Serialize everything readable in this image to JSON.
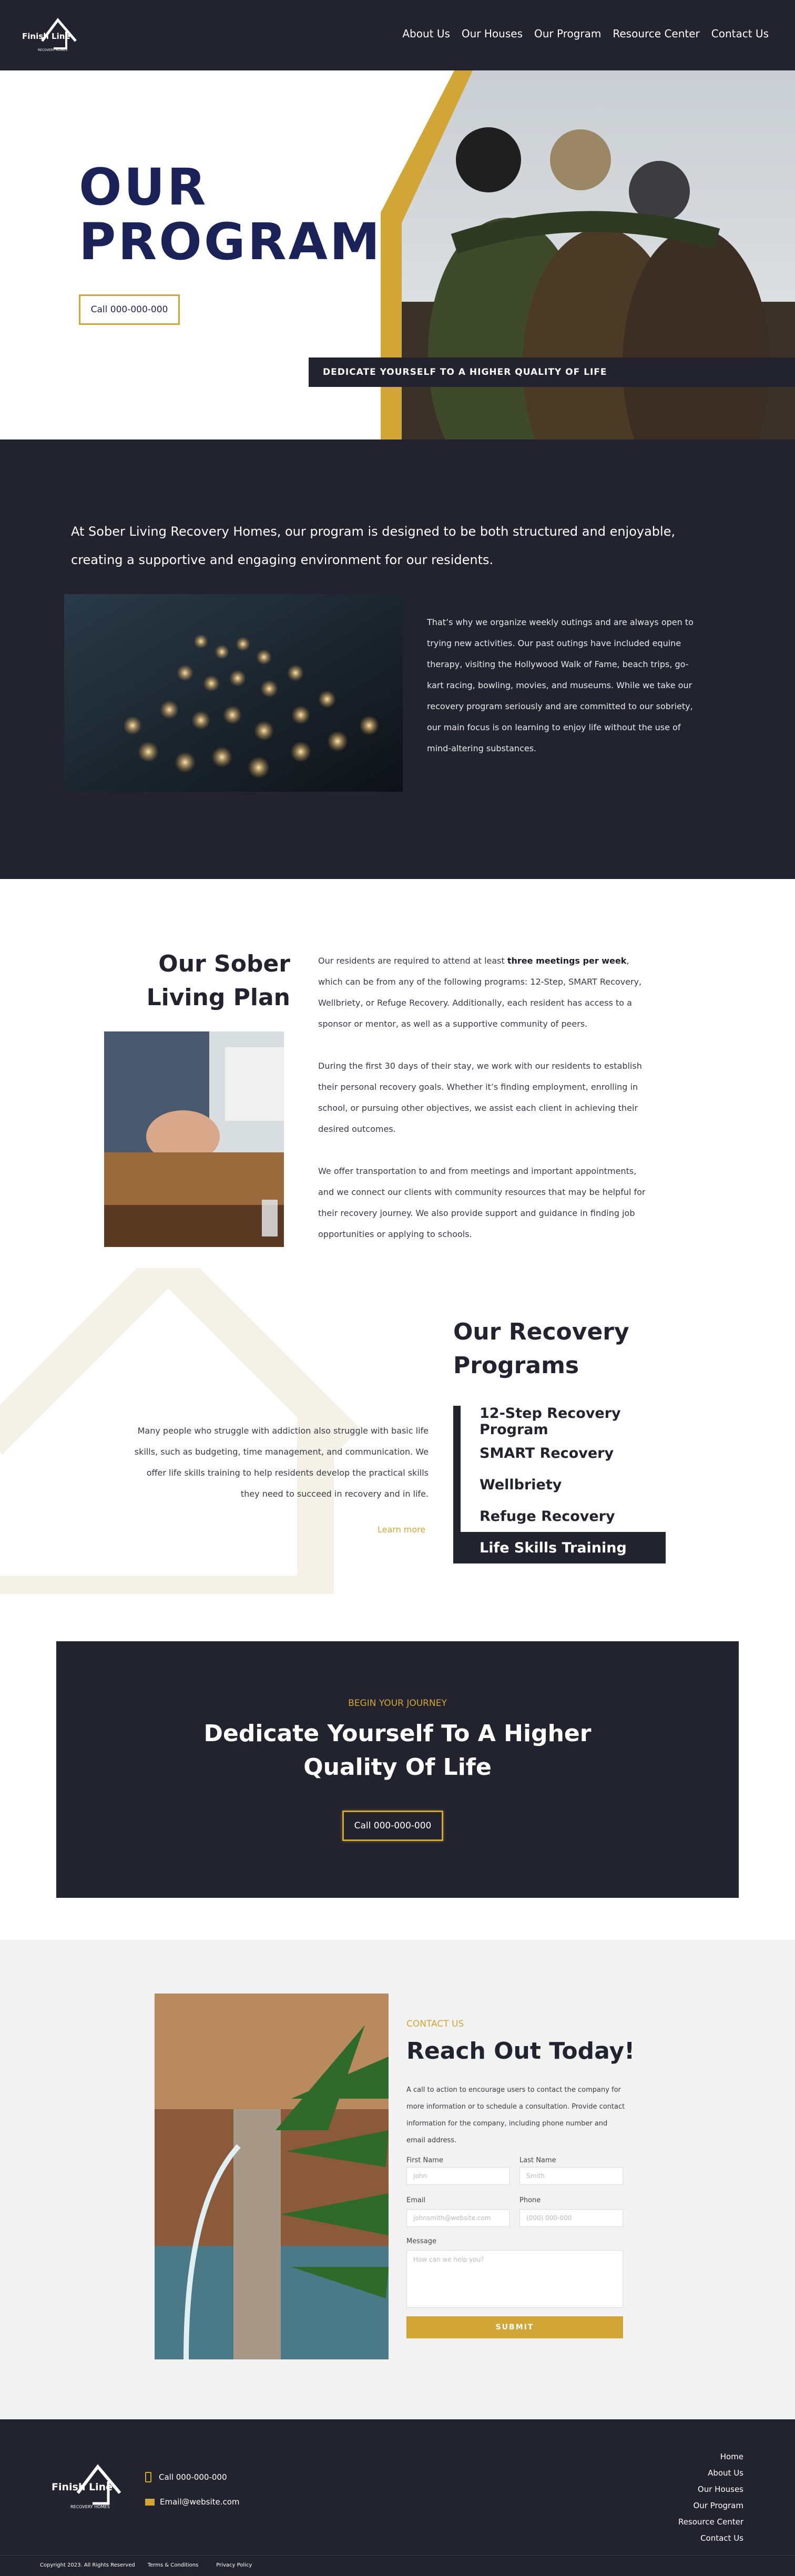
{
  "brand": {
    "name": "Finish Line",
    "tagline": "RECOVERY HOMES"
  },
  "nav": [
    "About Us",
    "Our Houses",
    "Our Program",
    "Resource Center",
    "Contact Us"
  ],
  "hero": {
    "title_line1": "OUR",
    "title_line2": "PROGRAM",
    "cta": "Call 000-000-000",
    "banner": "DEDICATE YOURSELF TO A HIGHER QUALITY OF LIFE"
  },
  "intro": {
    "lead": "At Sober Living Recovery Homes, our program is designed to be both structured and enjoyable, creating a supportive and engaging environment for our residents.",
    "body": "That’s why we organize weekly outings and are always open to trying new activities. Our past outings have included equine therapy, visiting the Hollywood Walk of Fame, beach trips, go-kart racing, bowling, movies, and museums. While we take our recovery program seriously and are committed to our sobriety, our main focus is on learning to enjoy life without the use of mind-altering substances."
  },
  "plan": {
    "heading_line1": "Our Sober",
    "heading_line2": "Living Plan",
    "p1_pre": "Our residents are required to attend at least ",
    "p1_bold": "three meetings per week",
    "p1_post": ", which can be from any of the following programs: 12-Step, SMART Recovery, Wellbriety, or Refuge Recovery. Additionally, each resident has access to a sponsor or mentor, as well as a supportive community of peers.",
    "p2": "During the first 30 days of their stay, we work with our residents to establish their personal recovery goals. Whether it’s finding employment, enrolling in school, or pursuing other objectives, we assist each client in achieving their desired outcomes.",
    "p3": "We offer transportation to and from meetings and important appointments, and we connect our clients with community resources that may be helpful for their recovery journey. We also provide support and guidance in finding job opportunities or applying to schools."
  },
  "programs": {
    "heading_line1": "Our Recovery",
    "heading_line2": "Programs",
    "text": "Many people who struggle with addiction also struggle with basic life skills, such as budgeting, time management, and communication. We offer life skills training to help residents develop the practical skills they need to succeed in recovery and in life.",
    "learn_more": "Learn more",
    "items": [
      "12-Step Recovery Program",
      "SMART Recovery",
      "Wellbriety",
      "Refuge Recovery",
      "Life Skills Training"
    ]
  },
  "cta": {
    "eyebrow": "BEGIN YOUR JOURNEY",
    "line1": "Dedicate Yourself To A Higher",
    "line2": "Quality Of Life",
    "button": "Call 000-000-000"
  },
  "contact": {
    "eyebrow": "CONTACT US",
    "heading": "Reach Out Today!",
    "text": "A call to action to encourage users to contact the company for more information or to schedule a consultation. Provide contact information for the company, including phone number and email address.",
    "first_label": "First Name",
    "first_ph": "John",
    "last_label": "Last Name",
    "last_ph": "Smith",
    "email_label": "Email",
    "email_ph": "johnsmith@website.com",
    "phone_label": "Phone",
    "phone_ph": "(000) 000-000",
    "message_label": "Message",
    "message_ph": "How can we help you?",
    "submit": "SUBMIT"
  },
  "footer": {
    "phone": "Call 000-000-000",
    "email": "Email@website.com",
    "links": [
      "Home",
      "About Us",
      "Our Houses",
      "Our Program",
      "Resource Center",
      "Contact Us"
    ],
    "copyright": "Copyright 2023. All Rights Reserved",
    "terms": "Terms & Conditions",
    "privacy": "Privacy Policy"
  },
  "colors": {
    "dark": "#23232f",
    "gold": "#d2a636",
    "navy": "#1b2257"
  }
}
